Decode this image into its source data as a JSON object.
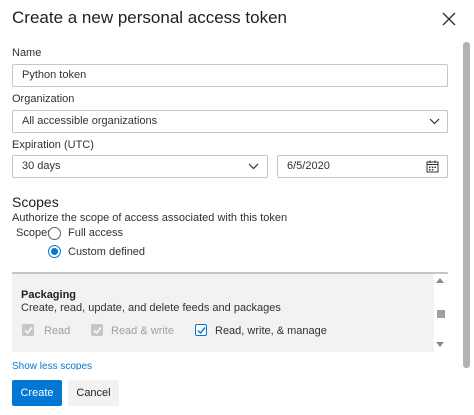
{
  "dialog": {
    "title": "Create a new personal access token",
    "close_icon": "close-icon"
  },
  "form": {
    "name_label": "Name",
    "name_value": "Python token",
    "organization_label": "Organization",
    "organization_value": "All accessible organizations",
    "expiration_label": "Expiration (UTC)",
    "expiration_value": "30 days",
    "expiration_date": "6/5/2020",
    "calendar_icon": "calendar-icon",
    "dropdown_icon": "chevron-down-icon"
  },
  "scopes": {
    "title": "Scopes",
    "description": "Authorize the scope of access associated with this token",
    "label": "Scopes",
    "options": [
      {
        "label": "Full access",
        "selected": false
      },
      {
        "label": "Custom defined",
        "selected": true
      }
    ]
  },
  "packaging": {
    "title": "Packaging",
    "description": "Create, read, update, and delete feeds and packages",
    "permissions": [
      {
        "label": "Read",
        "checked": true,
        "disabled": true
      },
      {
        "label": "Read & write",
        "checked": true,
        "disabled": true
      },
      {
        "label": "Read, write, & manage",
        "checked": true,
        "disabled": false
      }
    ]
  },
  "links": {
    "show_less": "Show less scopes"
  },
  "buttons": {
    "create": "Create",
    "cancel": "Cancel"
  },
  "colors": {
    "accent": "#0078d4",
    "border": "#c8c6c4",
    "panel": "#f3f2f1"
  }
}
